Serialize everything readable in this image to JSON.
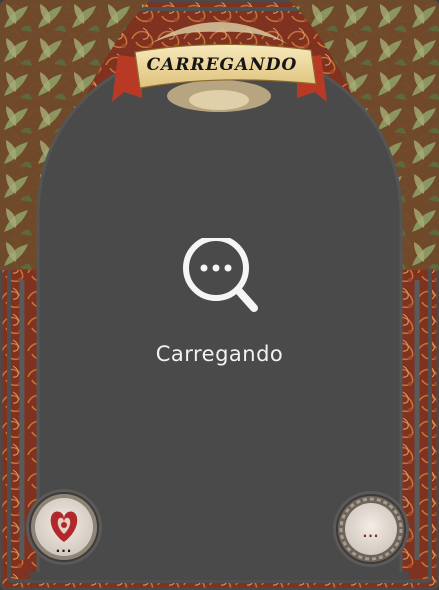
{
  "card": {
    "banner_title": "CARREGANDO",
    "loading_text": "Carregando",
    "left_badge": {
      "icon": "heart-suit-icon",
      "label": "..."
    },
    "right_badge": {
      "label": "..."
    },
    "center_icon": "search-loading-icon"
  },
  "colors": {
    "panel": "#4a4a4a",
    "frame_red": "#8e3a22",
    "leaf_green": "#7b8a55",
    "banner_parchment": "#f1dfa6",
    "ribbon_red": "#b83a25",
    "text_light": "#f2f2f2"
  }
}
